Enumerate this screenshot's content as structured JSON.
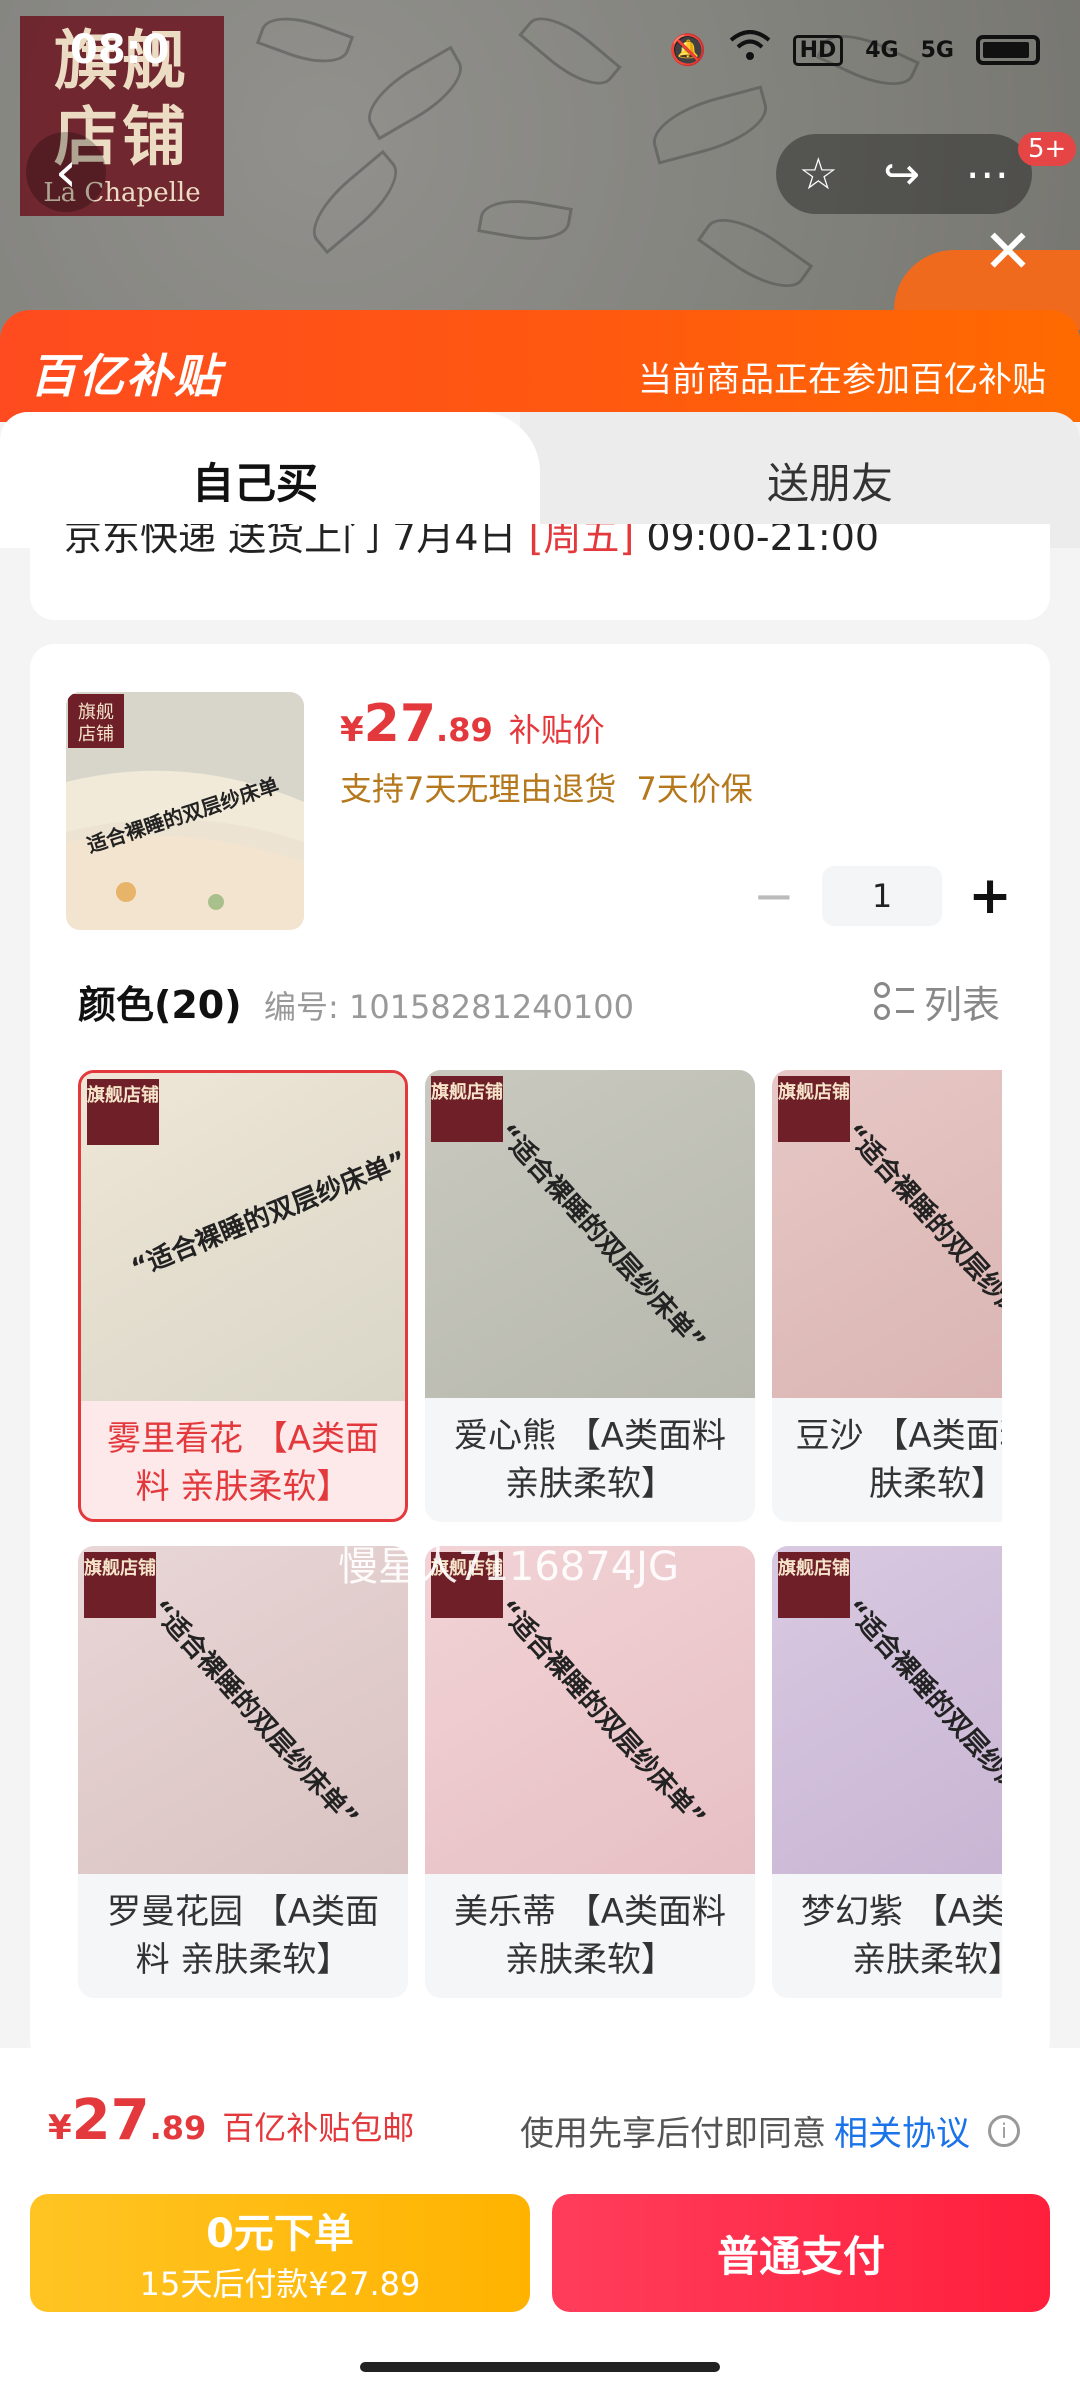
{
  "status_bar": {
    "time": "08:0",
    "network": "HD",
    "signal_4g": "4G",
    "signal_5g": "5G"
  },
  "header": {
    "store_logo_text": "旗舰店铺",
    "store_logo_sub": "La Chapelle",
    "notification_badge": "5+"
  },
  "subsidy": {
    "logo_text": "百亿补贴",
    "notice": "当前商品正在参加百亿补贴"
  },
  "tabs": {
    "self": "自己买",
    "gift": "送朋友"
  },
  "shipping": {
    "text": "京东快递 送货上门 7月4日",
    "tag": "[周五]",
    "time": "09:00-21:00"
  },
  "product": {
    "price_symbol": "¥",
    "price_int": "27",
    "price_dec": ".89",
    "price_tag": "补贴价",
    "return_policy": "支持7天无理由退货",
    "price_protect": "7天价保",
    "quantity": "1"
  },
  "color_section": {
    "title": "颜色(20)",
    "sku": "编号: 10158281240100",
    "toggle_label": "列表"
  },
  "swatches": [
    {
      "label": "雾里看花 【A类面料 亲肤柔软】",
      "colors": [
        "#efe6d6",
        "#d9d6c8"
      ],
      "selected": true
    },
    {
      "label": "爱心熊 【A类面料 亲肤柔软】",
      "colors": [
        "#c9c9bf",
        "#b7b8ad"
      ],
      "selected": false
    },
    {
      "label": "豆沙 【A类面料 亲肤柔软】",
      "colors": [
        "#e7c8c6",
        "#d8b2b0"
      ],
      "selected": false
    },
    {
      "label": "罗曼花园 【A类面料 亲肤柔软】",
      "colors": [
        "#e9d6d6",
        "#d9c2c2"
      ],
      "selected": false
    },
    {
      "label": "美乐蒂 【A类面料 亲肤柔软】",
      "colors": [
        "#f2d3d6",
        "#e6bfc4"
      ],
      "selected": false
    },
    {
      "label": "梦幻紫 【A类面料 亲肤柔软】",
      "colors": [
        "#d9c9e1",
        "#c6b3d2"
      ],
      "selected": false
    }
  ],
  "swatch_slogan": "适合裸睡的双层纱床单",
  "watermark": "慢星人7116874JG",
  "bottom": {
    "price_symbol": "¥",
    "price_int": "27",
    "price_dec": ".89",
    "price_note": "百亿补贴包邮",
    "agree_text": "使用先享后付即同意",
    "agree_link": "相关协议",
    "later_title": "0元下单",
    "later_sub": "15天后付款¥27.89",
    "pay_label": "普通支付"
  },
  "colors": {
    "accent_red": "#e4393c",
    "subsidy_orange": "#ff5a0e",
    "later_yellow": "#ffbd1a",
    "pay_red": "#ff2d4a"
  }
}
